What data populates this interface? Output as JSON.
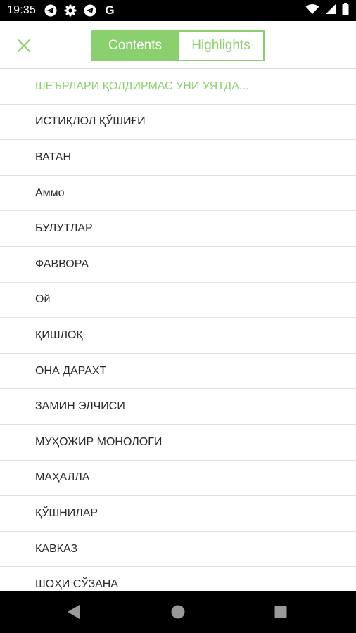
{
  "status_bar": {
    "time": "19:35",
    "left_icons": [
      "telegram-icon",
      "gear-icon",
      "telegram-icon",
      "google-icon"
    ],
    "google_letter": "G",
    "right_icons": [
      "wifi-icon",
      "signal-icon",
      "battery-icon"
    ]
  },
  "toolbar": {
    "close_icon": "close-icon",
    "tabs": [
      {
        "label": "Contents",
        "active": true
      },
      {
        "label": "Highlights",
        "active": false
      }
    ],
    "accent_color": "#8bd06f"
  },
  "contents": {
    "items": [
      {
        "label": "ШЕЪРЛАРИ ҚОЛДИРМАС УНИ УЯТДА...",
        "current": true
      },
      {
        "label": "ИСТИҚЛОЛ ҚЎШИҒИ",
        "current": false
      },
      {
        "label": "ВАТАН",
        "current": false
      },
      {
        "label": "Аммо",
        "current": false
      },
      {
        "label": "БУЛУТЛАР",
        "current": false
      },
      {
        "label": "ФАВВОРА",
        "current": false
      },
      {
        "label": "Ой",
        "current": false
      },
      {
        "label": "ҚИШЛОҚ",
        "current": false
      },
      {
        "label": "ОНА ДАРАХТ",
        "current": false
      },
      {
        "label": "ЗАМИН ЭЛЧИСИ",
        "current": false
      },
      {
        "label": "МУҲОЖИР МОНОЛОГИ",
        "current": false
      },
      {
        "label": "МАҲАЛЛА",
        "current": false
      },
      {
        "label": "ҚЎШНИЛАР",
        "current": false
      },
      {
        "label": "КАВКАЗ",
        "current": false
      },
      {
        "label": "ШОҲИ СЎЗАНА",
        "current": false
      }
    ]
  },
  "nav_bar": {
    "buttons": [
      "back-icon",
      "home-icon",
      "recents-icon"
    ]
  }
}
